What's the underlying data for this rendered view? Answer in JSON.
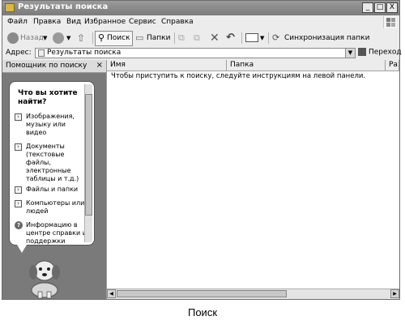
{
  "window": {
    "title": "Результаты поиска"
  },
  "titlebar_buttons": {
    "minimize": "_",
    "maximize": "□",
    "close": "X"
  },
  "menu": [
    "Файл",
    "Правка",
    "Вид",
    "Избранное",
    "Сервис",
    "Справка"
  ],
  "toolbar": {
    "back_label": "Назад",
    "search_label": "Поиск",
    "folders_label": "Папки",
    "sync_label": "Синхронизация папки"
  },
  "address": {
    "label": "Адрес:",
    "value": "Результаты поиска",
    "go_label": "Переход"
  },
  "left_pane": {
    "header": "Помощник по поиску",
    "close": "×",
    "question": "Что вы хотите найти?",
    "options": [
      {
        "label": "Изображения, музыку или видео",
        "icon": "arrow-icon"
      },
      {
        "label": "Документы (текстовые файлы, электронные таблицы и т.д.)",
        "icon": "arrow-icon"
      },
      {
        "label": "Файлы и папки",
        "icon": "arrow-icon"
      },
      {
        "label": "Компьютеры или людей",
        "icon": "arrow-icon"
      },
      {
        "label": "Информацию в центре справки и поддержки",
        "icon": "help-icon"
      }
    ]
  },
  "results": {
    "columns": [
      "Имя",
      "Папка",
      "Разм"
    ],
    "message": "Чтобы приступить к поиску, следуйте инструкциям на левой панели."
  },
  "caption": "Поиск"
}
